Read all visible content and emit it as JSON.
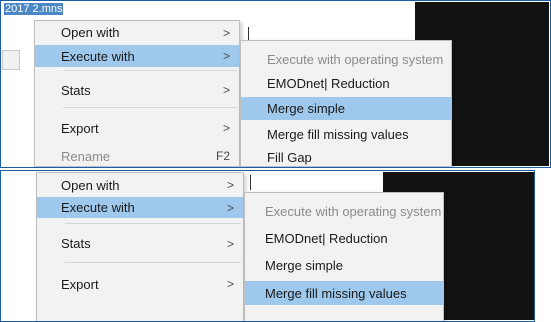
{
  "shots": [
    {
      "background_title": "2017 2.mns",
      "main_menu": {
        "items": [
          {
            "label": "Open with",
            "chevron": ">"
          },
          {
            "label": "Execute with",
            "chevron": ">",
            "highlighted": true
          },
          {
            "label": "Stats",
            "chevron": ">"
          },
          {
            "label": "Export",
            "chevron": ">"
          },
          {
            "label": "Rename",
            "shortcut": "F2",
            "disabled": true
          }
        ]
      },
      "submenu": {
        "items": [
          {
            "label": "Execute with operating system",
            "disabled": true
          },
          {
            "label": "EMODnet| Reduction"
          },
          {
            "label": "Merge simple",
            "highlighted": true
          },
          {
            "label": "Merge fill missing values"
          },
          {
            "label": "Fill Gap"
          }
        ]
      }
    },
    {
      "main_menu": {
        "items": [
          {
            "label": "Open with",
            "chevron": ">"
          },
          {
            "label": "Execute with",
            "chevron": ">",
            "highlighted": true
          },
          {
            "label": "Stats",
            "chevron": ">"
          },
          {
            "label": "Export",
            "chevron": ">"
          }
        ]
      },
      "submenu": {
        "items": [
          {
            "label": "Execute with operating system",
            "disabled": true
          },
          {
            "label": "EMODnet| Reduction"
          },
          {
            "label": "Merge simple"
          },
          {
            "label": "Merge fill missing values",
            "highlighted": true
          }
        ]
      }
    }
  ],
  "colors": {
    "highlight": "#9ec8ec",
    "frame_border": "#1b5ea6",
    "menu_background": "#f2f2f2"
  }
}
